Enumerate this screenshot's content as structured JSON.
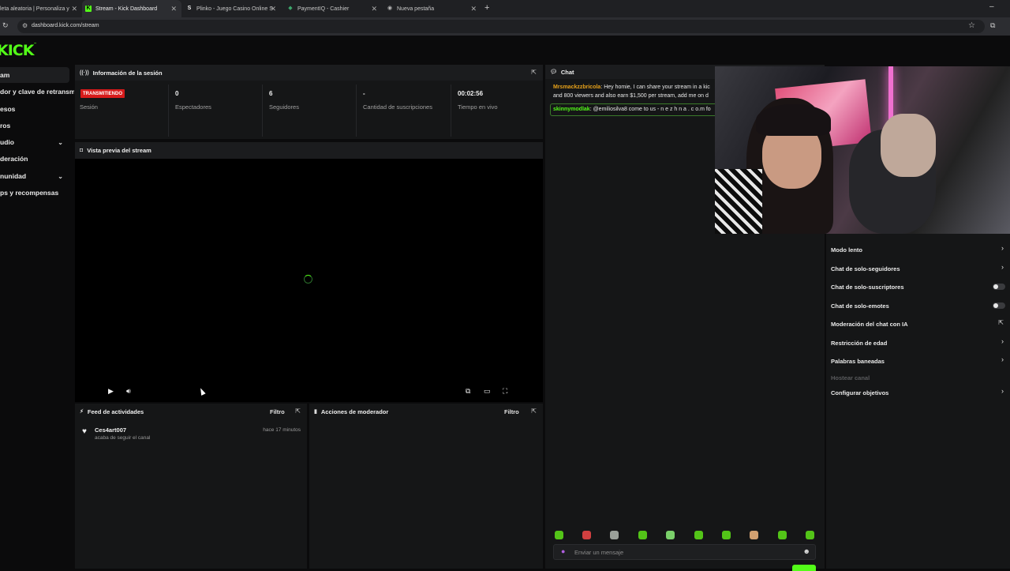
{
  "browser": {
    "tabs": [
      {
        "title": "leta aleatoria | Personaliza y",
        "icon": "spin-wheel-icon"
      },
      {
        "title": "Stream - Kick Dashboard",
        "icon": "kick-icon",
        "active": true
      },
      {
        "title": "Plinko - Juego Casino Online S",
        "icon": "stake-icon"
      },
      {
        "title": "PaymentIQ - Cashier",
        "icon": "paymentiq-icon"
      },
      {
        "title": "Nueva pestaña",
        "icon": "globe-icon"
      }
    ],
    "url": "dashboard.kick.com/stream"
  },
  "brand": {
    "logo": "KICK",
    "accent": "#53fc18"
  },
  "sidebar": {
    "items": [
      {
        "label": "am"
      },
      {
        "label": "dor y clave de retransmisión"
      },
      {
        "label": "esos"
      },
      {
        "label": "ros"
      },
      {
        "label": "udio"
      },
      {
        "label": "deración"
      },
      {
        "label": "nunidad"
      },
      {
        "label": "ps y recompensas"
      }
    ]
  },
  "session": {
    "title": "Información de la sesión",
    "live_badge": "TRANSMITIENDO",
    "session_label": "Sesión",
    "stats": [
      {
        "value": "0",
        "label": "Espectadores"
      },
      {
        "value": "6",
        "label": "Seguidores"
      },
      {
        "value": "-",
        "label": "Cantidad de suscripciones"
      },
      {
        "value": "00:02:56",
        "label": "Tiempo en vivo"
      }
    ]
  },
  "preview": {
    "title": "Vista previa del stream"
  },
  "feed": {
    "title": "Feed de actividades",
    "filter": "Filtro",
    "items": [
      {
        "user": "Ces4art007",
        "action": "acaba de seguir el canal",
        "time": "hace 17 minutos"
      }
    ]
  },
  "mod_actions": {
    "title": "Acciones de moderador",
    "filter": "Filtro"
  },
  "chat": {
    "title": "Chat",
    "messages": [
      {
        "user": "Mrsmackzzbricola",
        "text": ": Hey homie, I can share your stream in a kic",
        "text2": "and 800 viewers and also earn $1,500 per stream, add me on d",
        "color": "#e6a11a"
      },
      {
        "user": "skinnymodlak",
        "text": ": @emiliosilva8 come to us - n e z h n a . c o.m fo",
        "color": "#53fc18"
      }
    ],
    "input_placeholder": "Enviar un mensaje"
  },
  "settings": {
    "items": [
      {
        "label": "Modo lento",
        "control": "chevron"
      },
      {
        "label": "Chat de solo-seguidores",
        "control": "chevron"
      },
      {
        "label": "Chat de solo-suscriptores",
        "control": "toggle",
        "on": false
      },
      {
        "label": "Chat de solo-emotes",
        "control": "toggle",
        "on": false
      },
      {
        "label": "Moderación del chat con IA",
        "control": "external"
      },
      {
        "label": "Restricción de edad",
        "control": "chevron"
      },
      {
        "label": "Palabras baneadas",
        "control": "chevron"
      },
      {
        "label": "Hostear canal",
        "control": "none",
        "disabled": true
      },
      {
        "label": "Configurar objetivos",
        "control": "chevron"
      }
    ]
  }
}
